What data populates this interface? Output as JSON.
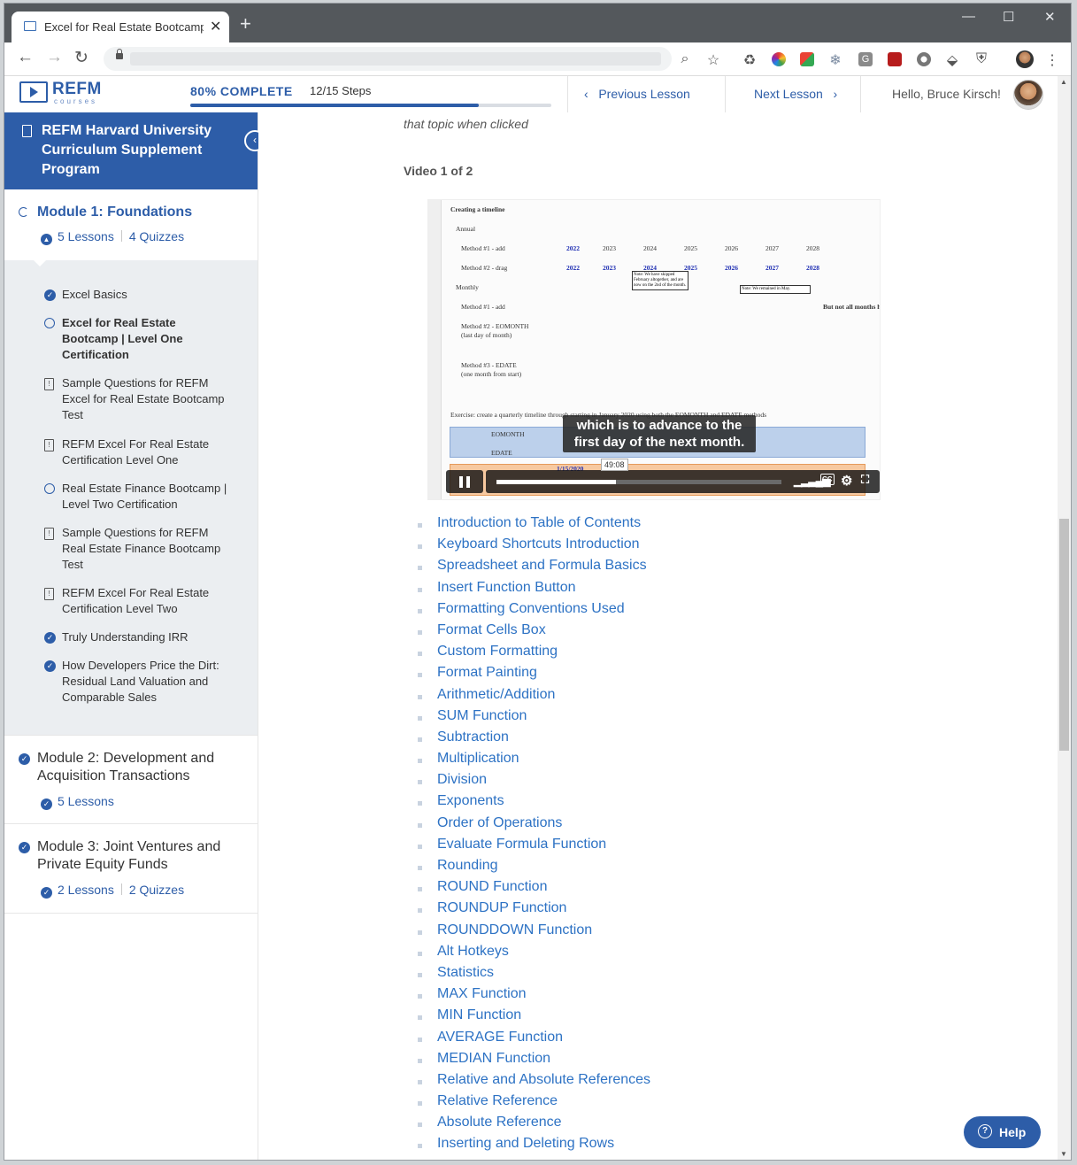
{
  "browser": {
    "tab_title": "Excel for Real Estate Bootcamp | l",
    "new_tab": "+",
    "close_tab": "✕",
    "win_min": "—",
    "win_max": "☐",
    "win_close": "✕"
  },
  "header": {
    "logo_name": "REFM",
    "logo_sub": "courses",
    "progress_label": "80% COMPLETE",
    "steps": "12/15 Steps",
    "progress_fraction": 0.8,
    "prev_lesson": "Previous Lesson",
    "next_lesson": "Next Lesson",
    "greeting": "Hello, Bruce Kirsch!"
  },
  "sidebar": {
    "program_title": "REFM Harvard University Curriculum Supplement Program",
    "module1": {
      "title": "Module 1: Foundations",
      "lessons": "5 Lessons",
      "quizzes": "4 Quizzes"
    },
    "items": [
      {
        "label": "Excel Basics",
        "status": "done"
      },
      {
        "label": "Excel for Real Estate Bootcamp | Level One Certification",
        "status": "open"
      },
      {
        "label": "Sample Questions for REFM Excel for Real Estate Bootcamp Test",
        "status": "quiz"
      },
      {
        "label": "REFM Excel For Real Estate Certification Level One",
        "status": "quiz"
      },
      {
        "label": "Real Estate Finance Bootcamp | Level Two Certification",
        "status": "open"
      },
      {
        "label": "Sample Questions for REFM Real Estate Finance Bootcamp Test",
        "status": "quiz"
      },
      {
        "label": "REFM Excel For Real Estate Certification Level Two",
        "status": "quiz"
      },
      {
        "label": "Truly Understanding IRR",
        "status": "done"
      },
      {
        "label": "How Developers Price the Dirt: Residual Land Valuation and Comparable Sales",
        "status": "done"
      }
    ],
    "module2": {
      "title": "Module 2: Development and Acquisition Transactions",
      "lessons": "5 Lessons"
    },
    "module3": {
      "title": "Module 3: Joint Ventures and Private Equity Funds",
      "lessons": "2 Lessons",
      "quizzes": "2 Quizzes"
    }
  },
  "main": {
    "topic_text": "that topic when clicked",
    "video_label": "Video 1 of 2",
    "video": {
      "caption": "which is to advance to the first day of the next month.",
      "time": "49:08",
      "progress_fraction": 0.42,
      "sheet": {
        "title": "Creating a timeline",
        "annual": "Annual",
        "monthly": "Monthly",
        "method1_add": "Method #1 - add",
        "method2_drag": "Method #2 - drag",
        "method2_eomonth": "Method #2 - EOMONTH",
        "last_day": "(last day of month)",
        "method3_edate": "Method #3 - EDATE",
        "one_month": "(one month from start)",
        "years": [
          "2022",
          "2023",
          "2024",
          "2025",
          "2026",
          "2027",
          "2028"
        ],
        "note1": "Note: We have skipped February altogether, and are now on the 2nd of the month.",
        "note2": "Note: We remained in May.",
        "not_all": "But not all months h",
        "exercise": "Exercise: create a quarterly timeline through starting in January 2020 using both the EOMONTH and EDATE methods",
        "eomonth": "EOMONTH",
        "edate": "EDATE",
        "start_date": "1/15/2020"
      }
    },
    "toc": [
      "Introduction to Table of Contents",
      "Keyboard Shortcuts Introduction",
      "Spreadsheet and Formula Basics",
      "Insert Function Button",
      "Formatting Conventions Used",
      "Format Cells Box",
      "Custom Formatting",
      "Format Painting",
      "Arithmetic/Addition",
      "SUM Function",
      "Subtraction",
      "Multiplication",
      "Division",
      "Exponents",
      "Order of Operations",
      "Evaluate Formula Function",
      "Rounding",
      "ROUND Function",
      "ROUNDUP Function",
      "ROUNDDOWN Function",
      "Alt Hotkeys",
      "Statistics",
      "MAX Function",
      "MIN Function",
      "AVERAGE Function",
      "MEDIAN Function",
      "Relative and Absolute References",
      "Relative Reference",
      "Absolute Reference",
      "Inserting and Deleting Rows"
    ]
  },
  "help_label": "Help",
  "colors": {
    "brand": "#2d5da8",
    "link": "#2d72c4",
    "band_blue": "#bcd0eb",
    "band_orange": "#f7c9a0"
  }
}
